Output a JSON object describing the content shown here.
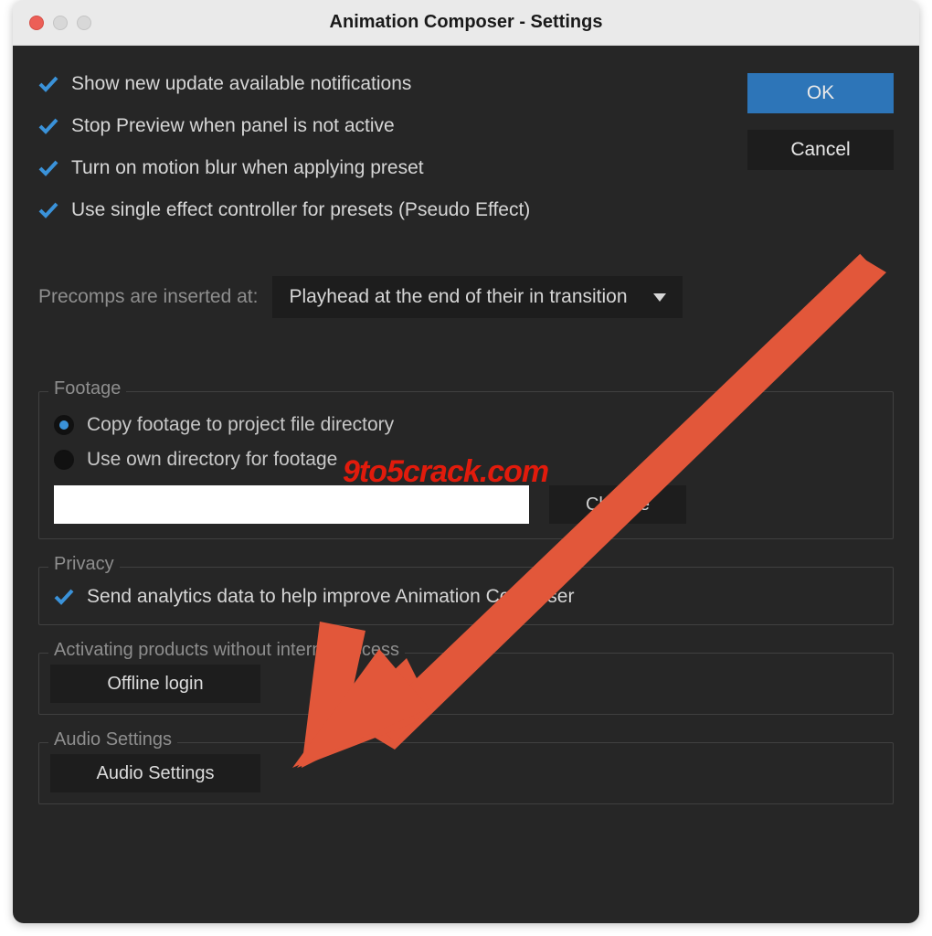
{
  "window": {
    "title": "Animation Composer - Settings"
  },
  "buttons": {
    "ok": "OK",
    "cancel": "Cancel"
  },
  "checks": [
    {
      "label": "Show new update available notifications",
      "checked": true
    },
    {
      "label": "Stop Preview when panel is not active",
      "checked": true
    },
    {
      "label": "Turn on motion blur when applying preset",
      "checked": true
    },
    {
      "label": "Use single effect controller for presets (Pseudo Effect)",
      "checked": true
    }
  ],
  "precomp": {
    "label": "Precomps are inserted at:",
    "selected": "Playhead at the end of their in transition"
  },
  "footage": {
    "legend": "Footage",
    "options": [
      {
        "label": "Copy footage to project file directory",
        "selected": true
      },
      {
        "label": "Use own directory for footage",
        "selected": false
      }
    ],
    "path": "",
    "change": "Change"
  },
  "privacy": {
    "legend": "Privacy",
    "label": "Send analytics data to help improve Animation Composer",
    "checked": true
  },
  "activating": {
    "legend": "Activating products without internet access",
    "button": "Offline login"
  },
  "audio": {
    "legend": "Audio Settings",
    "button": "Audio Settings"
  },
  "watermark": "9to5crack.com",
  "colors": {
    "accent": "#2d75b8",
    "arrow": "#e2573a"
  }
}
